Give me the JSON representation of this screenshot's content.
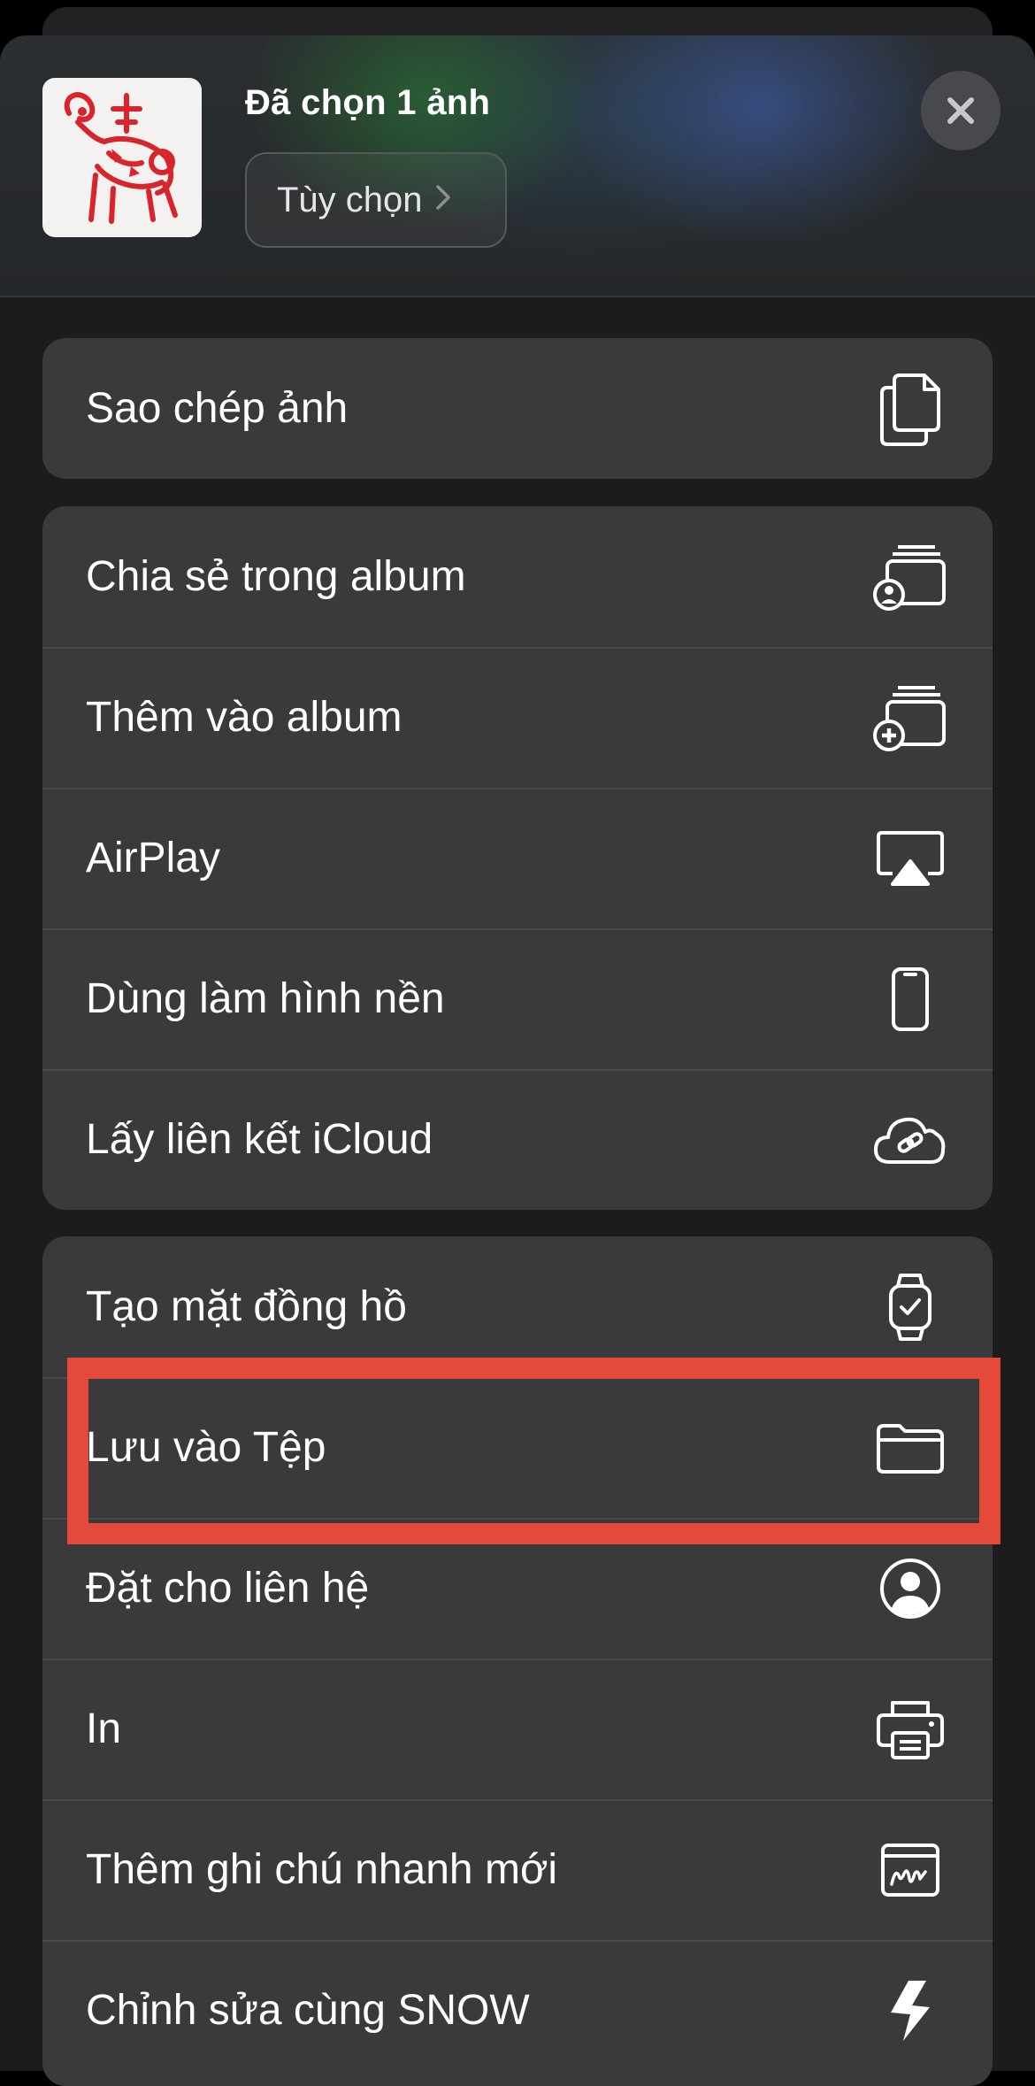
{
  "header": {
    "title": "Đã chọn 1 ảnh",
    "options_label": "Tùy chọn"
  },
  "groups": [
    {
      "items": [
        {
          "label": "Sao chép ảnh",
          "icon": "copy-icon"
        }
      ]
    },
    {
      "items": [
        {
          "label": "Chia sẻ trong album",
          "icon": "shared-album-icon"
        },
        {
          "label": "Thêm vào album",
          "icon": "add-album-icon"
        },
        {
          "label": "AirPlay",
          "icon": "airplay-icon"
        },
        {
          "label": "Dùng làm hình nền",
          "icon": "iphone-icon"
        },
        {
          "label": "Lấy liên kết iCloud",
          "icon": "cloud-link-icon"
        }
      ]
    },
    {
      "items": [
        {
          "label": "Tạo mặt đồng hồ",
          "icon": "watch-icon"
        },
        {
          "label": "Lưu vào Tệp",
          "icon": "folder-icon",
          "highlighted": true
        },
        {
          "label": "Đặt cho liên hệ",
          "icon": "contact-icon"
        },
        {
          "label": "In",
          "icon": "printer-icon"
        },
        {
          "label": "Thêm ghi chú nhanh mới",
          "icon": "quick-note-icon"
        },
        {
          "label": "Chỉnh sửa cùng SNOW",
          "icon": "snow-icon"
        }
      ]
    }
  ],
  "colors": {
    "sheet_bg": "#1c1c1e",
    "row_bg": "#3a3a3c",
    "highlight": "#e4493a",
    "text": "#ffffff"
  }
}
